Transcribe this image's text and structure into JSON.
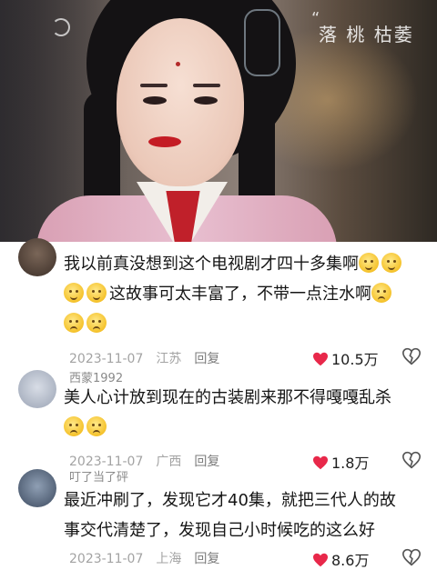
{
  "video": {
    "watermark": "落 桃 枯萎"
  },
  "comments": [
    {
      "username": "",
      "lines": [
        "我以前真没想到这个电视剧才四十多集啊",
        "这故事可太丰富了，不带一点注水啊"
      ],
      "date": "2023-11-07",
      "location": "江苏",
      "reply_label": "回复",
      "likes": "10.5万"
    },
    {
      "username": "西蒙1992",
      "lines": [
        "美人心计放到现在的古装剧来那不得嘎嘎乱杀"
      ],
      "date": "2023-11-07",
      "location": "广西",
      "reply_label": "回复",
      "likes": "1.8万"
    },
    {
      "username": "叮了当了砰",
      "lines": [
        "最近冲刷了，发现它才40集，就把三代人的故",
        "事交代清楚了，发现自己小时候吃的这么好"
      ],
      "date": "2023-11-07",
      "location": "上海",
      "reply_label": "回复",
      "likes": "8.6万"
    }
  ],
  "colors": {
    "heart": "#e8284a",
    "meta": "#a3a3a3",
    "text": "#161616"
  },
  "icons": [
    "heart-icon",
    "dislike-icon",
    "smile-emoji",
    "cry-emoji"
  ]
}
